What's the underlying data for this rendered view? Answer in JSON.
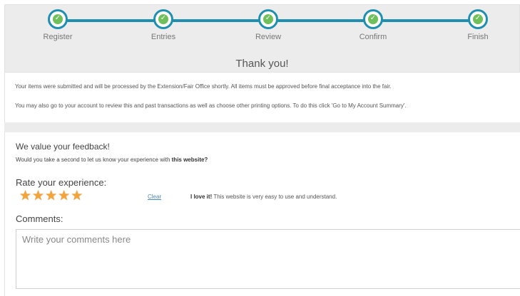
{
  "steps": [
    {
      "label": "Register",
      "done": true
    },
    {
      "label": "Entries",
      "done": true
    },
    {
      "label": "Review",
      "done": true
    },
    {
      "label": "Confirm",
      "done": true
    },
    {
      "label": "Finish",
      "done": true
    }
  ],
  "thanks_title": "Thank you!",
  "messages": {
    "submitted": "Your items were submitted and will be processed by the Extension/Fair Office shortly. All items must be approved before final acceptance into the fair.",
    "account": "You may also go to your account to review this and past transactions as well as choose other printing options. To do this click 'Go to My Account Summary'."
  },
  "feedback": {
    "title": "We value your feedback!",
    "question_prefix": "Would you take a second to let us know your experience with ",
    "question_bold": "this website?",
    "rate_title": "Rate your experience:",
    "rating": 5,
    "rating_max": 5,
    "clear_label": "Clear",
    "rating_text_bold": "I love it!",
    "rating_text": " This website is very easy to use and understand.",
    "comments_title": "Comments:",
    "comments_placeholder": "Write your comments here",
    "comments_value": ""
  },
  "colors": {
    "accent": "#1f8fb0",
    "check": "#6fbf5a",
    "star": "#f2a33a",
    "link": "#4d86b8"
  },
  "icons": {
    "step": "check-icon",
    "rating": "star-icon"
  }
}
